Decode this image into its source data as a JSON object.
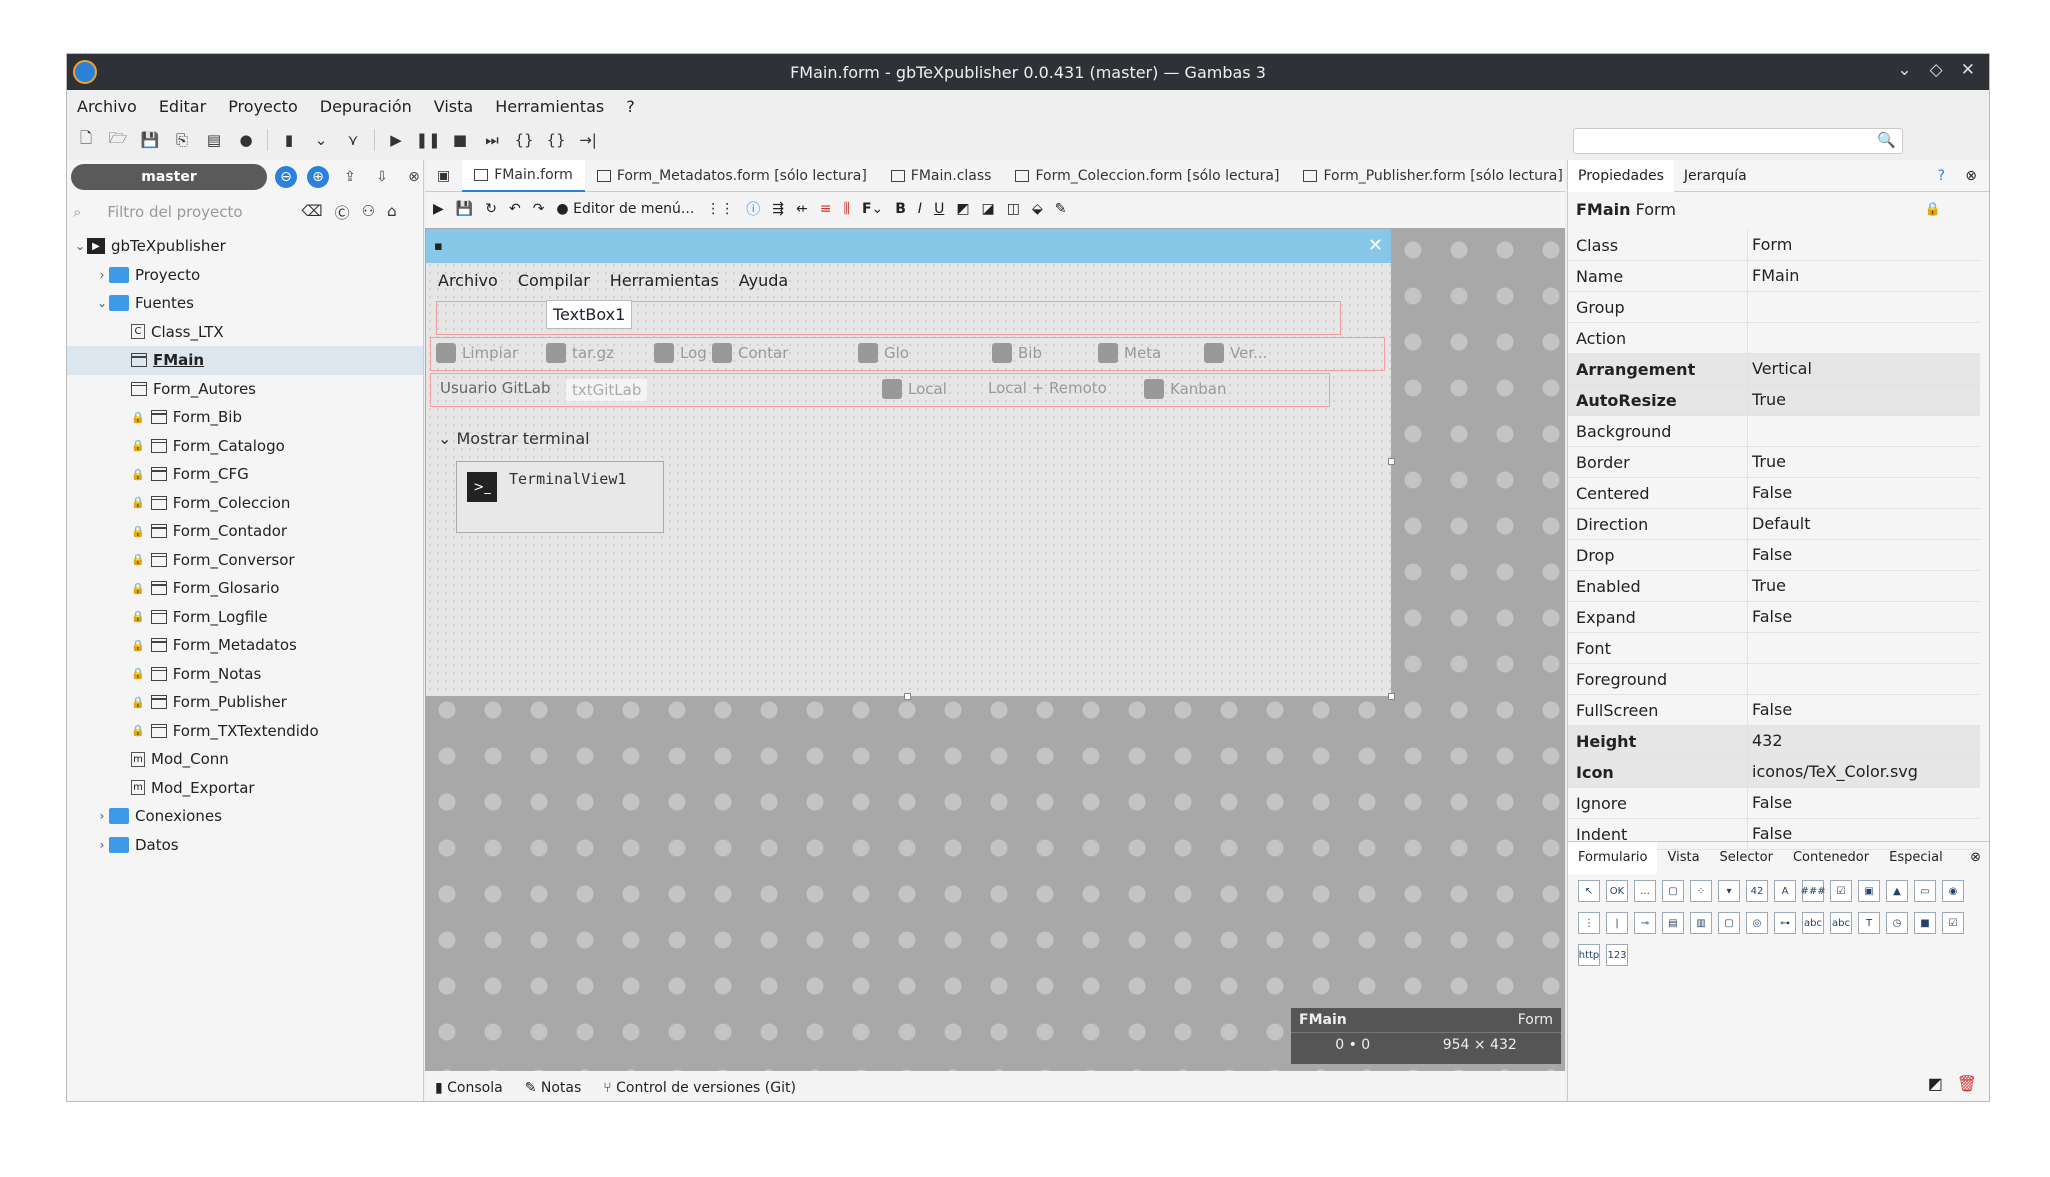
{
  "window": {
    "title": "FMain.form - gbTeXpublisher 0.0.431 (master) — Gambas 3"
  },
  "menubar": [
    "Archivo",
    "Editar",
    "Proyecto",
    "Depuración",
    "Vista",
    "Herramientas",
    "?"
  ],
  "project": {
    "branch": "master",
    "filter_placeholder": "Filtro del proyecto",
    "tree": [
      {
        "label": "gbTeXpublisher",
        "type": "project",
        "level": 0,
        "expanded": true
      },
      {
        "label": "Proyecto",
        "type": "folder",
        "level": 1,
        "expanded": false
      },
      {
        "label": "Fuentes",
        "type": "folder",
        "level": 1,
        "expanded": true
      },
      {
        "label": "Class_LTX",
        "type": "class",
        "level": 2
      },
      {
        "label": "FMain",
        "type": "form",
        "level": 2,
        "selected": true
      },
      {
        "label": "Form_Autores",
        "type": "form",
        "level": 2
      },
      {
        "label": "Form_Bib",
        "type": "form",
        "level": 2,
        "locked": true
      },
      {
        "label": "Form_Catalogo",
        "type": "form",
        "level": 2,
        "locked": true
      },
      {
        "label": "Form_CFG",
        "type": "form",
        "level": 2,
        "locked": true
      },
      {
        "label": "Form_Coleccion",
        "type": "form",
        "level": 2,
        "locked": true
      },
      {
        "label": "Form_Contador",
        "type": "form",
        "level": 2,
        "locked": true
      },
      {
        "label": "Form_Conversor",
        "type": "form",
        "level": 2,
        "locked": true
      },
      {
        "label": "Form_Glosario",
        "type": "form",
        "level": 2,
        "locked": true
      },
      {
        "label": "Form_Logfile",
        "type": "form",
        "level": 2,
        "locked": true
      },
      {
        "label": "Form_Metadatos",
        "type": "form",
        "level": 2,
        "locked": true
      },
      {
        "label": "Form_Notas",
        "type": "form",
        "level": 2,
        "locked": true
      },
      {
        "label": "Form_Publisher",
        "type": "form",
        "level": 2,
        "locked": true
      },
      {
        "label": "Form_TXTextendido",
        "type": "form",
        "level": 2,
        "locked": true
      },
      {
        "label": "Mod_Conn",
        "type": "module",
        "level": 2
      },
      {
        "label": "Mod_Exportar",
        "type": "module",
        "level": 2
      },
      {
        "label": "Conexiones",
        "type": "folder",
        "level": 1,
        "expanded": false
      },
      {
        "label": "Datos",
        "type": "folder",
        "level": 1,
        "expanded": false
      }
    ]
  },
  "editor_tabs": [
    {
      "label": "FMain.form",
      "active": true
    },
    {
      "label": "Form_Metadatos.form [sólo lectura]"
    },
    {
      "label": "FMain.class"
    },
    {
      "label": "Form_Coleccion.form [sólo lectura]"
    },
    {
      "label": "Form_Publisher.form [sólo lectura]"
    }
  ],
  "editor_toolbar": {
    "menu_editor": "Editor de menú..."
  },
  "form_preview": {
    "menu": [
      "Archivo",
      "Compilar",
      "Herramientas",
      "Ayuda"
    ],
    "textbox": "TextBox1",
    "row1": [
      "Limpiar",
      "tar.gz",
      "Log",
      "Contar",
      "Glo",
      "Bib",
      "Meta",
      "Ver..."
    ],
    "row2": [
      "Usuario GitLab",
      "txtGitLab",
      "Local",
      "Local + Remoto",
      "Kanban"
    ],
    "expander": "Mostrar terminal",
    "terminal": "TerminalView1"
  },
  "info_box": {
    "name": "FMain",
    "class": "Form",
    "pos": "0 • 0",
    "size": "954 × 432"
  },
  "statusbar": [
    "Consola",
    "Notas",
    "Control de versiones (Git)"
  ],
  "properties": {
    "tabs": [
      "Propiedades",
      "Jerarquía"
    ],
    "header_name": "FMain",
    "header_class": "Form",
    "rows": [
      {
        "k": "Class",
        "v": "Form"
      },
      {
        "k": "Name",
        "v": "FMain"
      },
      {
        "k": "Group",
        "v": ""
      },
      {
        "k": "Action",
        "v": ""
      },
      {
        "k": "Arrangement",
        "v": "Vertical",
        "bold": true
      },
      {
        "k": "AutoResize",
        "v": "True",
        "bold": true
      },
      {
        "k": "Background",
        "v": ""
      },
      {
        "k": "Border",
        "v": "True"
      },
      {
        "k": "Centered",
        "v": "False"
      },
      {
        "k": "Direction",
        "v": "Default"
      },
      {
        "k": "Drop",
        "v": "False"
      },
      {
        "k": "Enabled",
        "v": "True"
      },
      {
        "k": "Expand",
        "v": "False"
      },
      {
        "k": "Font",
        "v": ""
      },
      {
        "k": "Foreground",
        "v": ""
      },
      {
        "k": "FullScreen",
        "v": "False"
      },
      {
        "k": "Height",
        "v": "432",
        "bold": true
      },
      {
        "k": "Icon",
        "v": "iconos/TeX_Color.svg",
        "bold": true
      },
      {
        "k": "Ignore",
        "v": "False"
      },
      {
        "k": "Indent",
        "v": "False"
      }
    ]
  },
  "palette_tabs": [
    "Formulario",
    "Vista",
    "Selector",
    "Contenedor",
    "Especial"
  ],
  "palette_items": [
    "↖",
    "OK",
    "…",
    "▢",
    "⁘",
    "▾",
    "42",
    "A",
    "###",
    "☑",
    "▣",
    "▲",
    "▭",
    "◉",
    "⋮",
    "|",
    "⊸",
    "▤",
    "▥",
    "▢",
    "◎",
    "⊶",
    "abc",
    "abc",
    "T",
    "◷",
    "■",
    "☑",
    "http",
    "123"
  ],
  "colors": {
    "accent": "#2c82d8",
    "form_title": "#87c8e8",
    "titlebar": "#2e3135"
  }
}
